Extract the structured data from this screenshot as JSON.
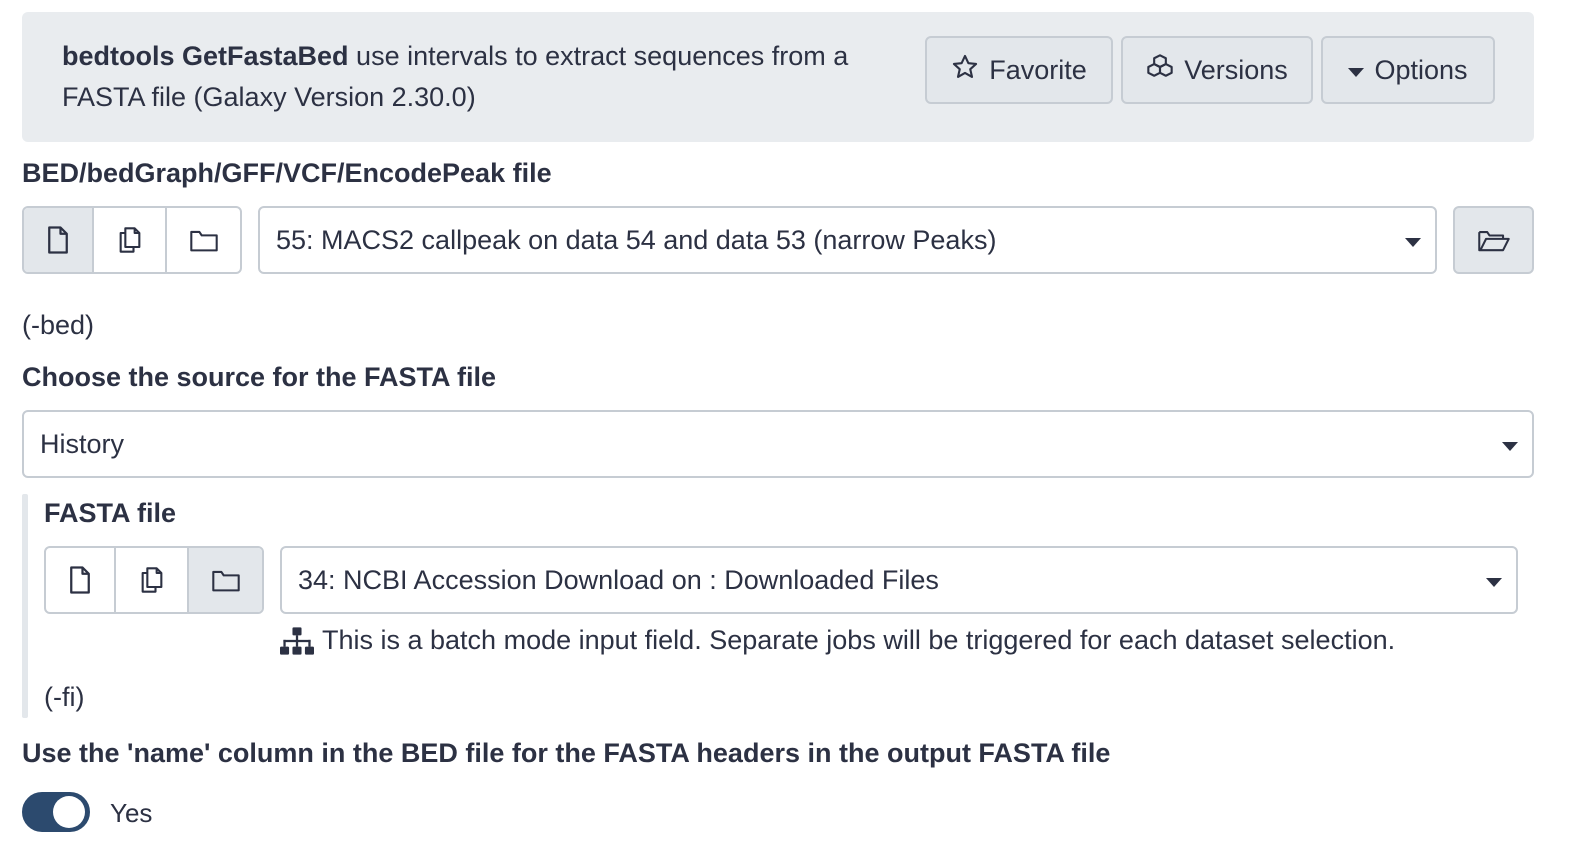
{
  "header": {
    "tool_name": "bedtools GetFastaBed",
    "description": " use intervals to extract sequences from a FASTA file (Galaxy Version 2.30.0)",
    "favorite_label": "Favorite",
    "versions_label": "Versions",
    "options_label": "Options"
  },
  "bed_input": {
    "label": "BED/bedGraph/GFF/VCF/EncodePeak file",
    "selected": "55: MACS2 callpeak on data 54 and data 53 (narrow Peaks)",
    "help": "(-bed)"
  },
  "fasta_source": {
    "label": "Choose the source for the FASTA file",
    "selected": "History"
  },
  "fasta_input": {
    "label": "FASTA file",
    "selected": "34: NCBI Accession Download on : Downloaded Files",
    "batch_note": "This is a batch mode input field. Separate jobs will be triggered for each dataset selection.",
    "help": "(-fi)"
  },
  "name_option": {
    "label": "Use the 'name' column in the BED file for the FASTA headers in the output FASTA file",
    "value_label": "Yes",
    "enabled": true
  },
  "colors": {
    "header_bg": "#e9ecef",
    "toggle_on": "#2c4a6e",
    "text": "#2c3143"
  }
}
